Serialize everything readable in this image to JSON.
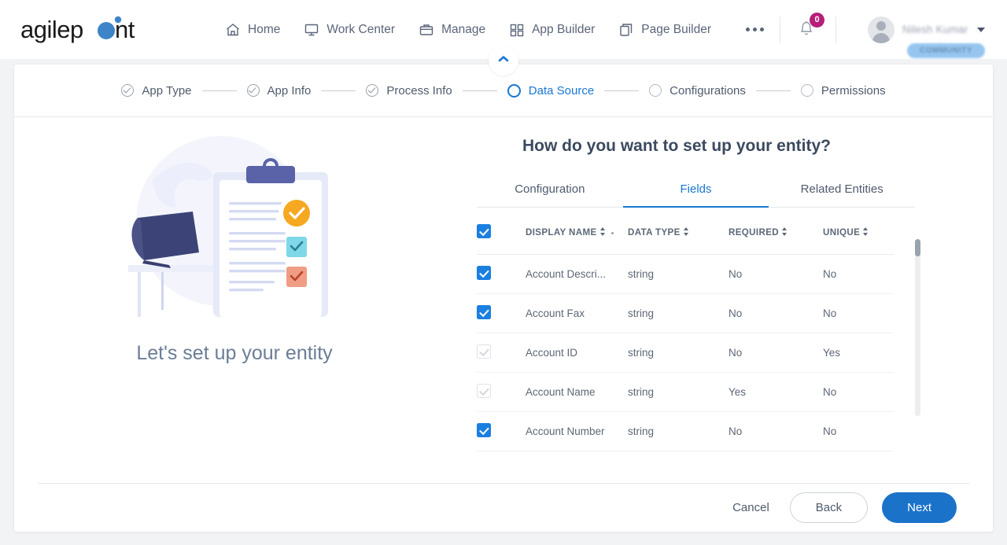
{
  "brand": {
    "name": "agilepoint",
    "accent": "#3d85c8"
  },
  "topnav": {
    "items": [
      {
        "label": "Home",
        "icon": "home-icon"
      },
      {
        "label": "Work Center",
        "icon": "monitor-icon"
      },
      {
        "label": "Manage",
        "icon": "briefcase-icon"
      },
      {
        "label": "App Builder",
        "icon": "grid-icon"
      },
      {
        "label": "Page Builder",
        "icon": "copy-icon"
      }
    ],
    "more_label": "",
    "notifications": {
      "icon": "bell-icon",
      "count": "0",
      "badge_color": "#b51f78"
    },
    "user": {
      "name": "Nilesh Kumar",
      "badge": "COMMUNITY",
      "avatar": "avatar-icon"
    }
  },
  "collapse": {
    "icon": "chevron-up-icon"
  },
  "stepper": {
    "steps": [
      {
        "label": "App Type",
        "state": "done"
      },
      {
        "label": "App Info",
        "state": "done"
      },
      {
        "label": "Process Info",
        "state": "done"
      },
      {
        "label": "Data Source",
        "state": "active"
      },
      {
        "label": "Configurations",
        "state": "todo"
      },
      {
        "label": "Permissions",
        "state": "todo"
      }
    ],
    "active_color": "#1977d4"
  },
  "left": {
    "caption": "Let's set up your entity",
    "illustration": "clipboard-checklist-desk-illustration"
  },
  "main": {
    "title": "How do you want to set up your entity?",
    "tabs": [
      {
        "label": "Configuration",
        "active": false
      },
      {
        "label": "Fields",
        "active": true
      },
      {
        "label": "Related Entities",
        "active": false
      }
    ],
    "table": {
      "select_all": true,
      "columns": [
        {
          "label": "DISPLAY NAME",
          "sortable": true
        },
        {
          "label": "DATA TYPE",
          "sortable": true
        },
        {
          "label": "REQUIRED",
          "sortable": true
        },
        {
          "label": "UNIQUE",
          "sortable": true
        }
      ],
      "rows": [
        {
          "checked": true,
          "disabled": false,
          "display_name": "Account Descri...",
          "data_type": "string",
          "required": "No",
          "unique": "No"
        },
        {
          "checked": true,
          "disabled": false,
          "display_name": "Account Fax",
          "data_type": "string",
          "required": "No",
          "unique": "No"
        },
        {
          "checked": true,
          "disabled": true,
          "display_name": "Account ID",
          "data_type": "string",
          "required": "No",
          "unique": "Yes"
        },
        {
          "checked": true,
          "disabled": true,
          "display_name": "Account Name",
          "data_type": "string",
          "required": "Yes",
          "unique": "No"
        },
        {
          "checked": true,
          "disabled": false,
          "display_name": "Account Number",
          "data_type": "string",
          "required": "No",
          "unique": "No"
        }
      ]
    }
  },
  "footer": {
    "cancel_label": "Cancel",
    "back_label": "Back",
    "next_label": "Next",
    "next_color": "#1b72c9"
  }
}
